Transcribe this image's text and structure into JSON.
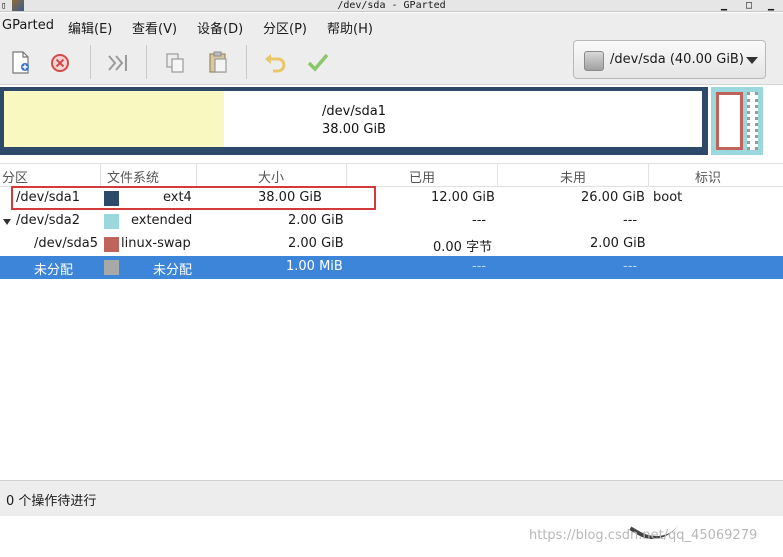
{
  "window": {
    "title": "/dev/sda - GParted",
    "app_icon_glyph": "▯"
  },
  "menu": [
    "GParted",
    "编辑(E)",
    "查看(V)",
    "设备(D)",
    "分区(P)",
    "帮助(H)"
  ],
  "toolbar": {
    "icons": [
      "new-partition-icon",
      "delete-icon",
      "resize-move-icon",
      "copy-icon",
      "paste-icon",
      "undo-icon",
      "apply-icon"
    ]
  },
  "device_selector": {
    "label": "/dev/sda (40.00 GiB)",
    "icon": "hard-disk-icon"
  },
  "disk_map": {
    "partition_name": "/dev/sda1",
    "partition_size": "38.00 GiB",
    "used_fraction": 0.316
  },
  "columns": [
    "分区",
    "文件系统",
    "大小",
    "已用",
    "未用",
    "标识"
  ],
  "rows": [
    {
      "partition": "/dev/sda1",
      "filesystem": "ext4",
      "size": "38.00 GiB",
      "used": "12.00 GiB",
      "unused": "26.00 GiB",
      "flags": "boot"
    },
    {
      "partition": "/dev/sda2",
      "filesystem": "extended",
      "size": "2.00 GiB",
      "used": "---",
      "unused": "---",
      "flags": ""
    },
    {
      "partition": "/dev/sda5",
      "filesystem": "linux-swap",
      "size": "2.00 GiB",
      "used": "0.00 字节",
      "unused": "2.00 GiB",
      "flags": ""
    },
    {
      "partition": "未分配",
      "filesystem": "未分配",
      "size": "1.00 MiB",
      "used": "---",
      "unused": "---",
      "flags": ""
    }
  ],
  "colors": {
    "ext4": "#2e4a6b",
    "extended": "#9ad8de",
    "linux_swap": "#c0635a",
    "unallocated": "#a8a8a8",
    "selection": "#3d85d8",
    "highlight_box": "#d33a3a"
  },
  "status": {
    "text": "0 个操作待进行"
  },
  "watermark": "https://blog.csdn.net/qq_45069279"
}
